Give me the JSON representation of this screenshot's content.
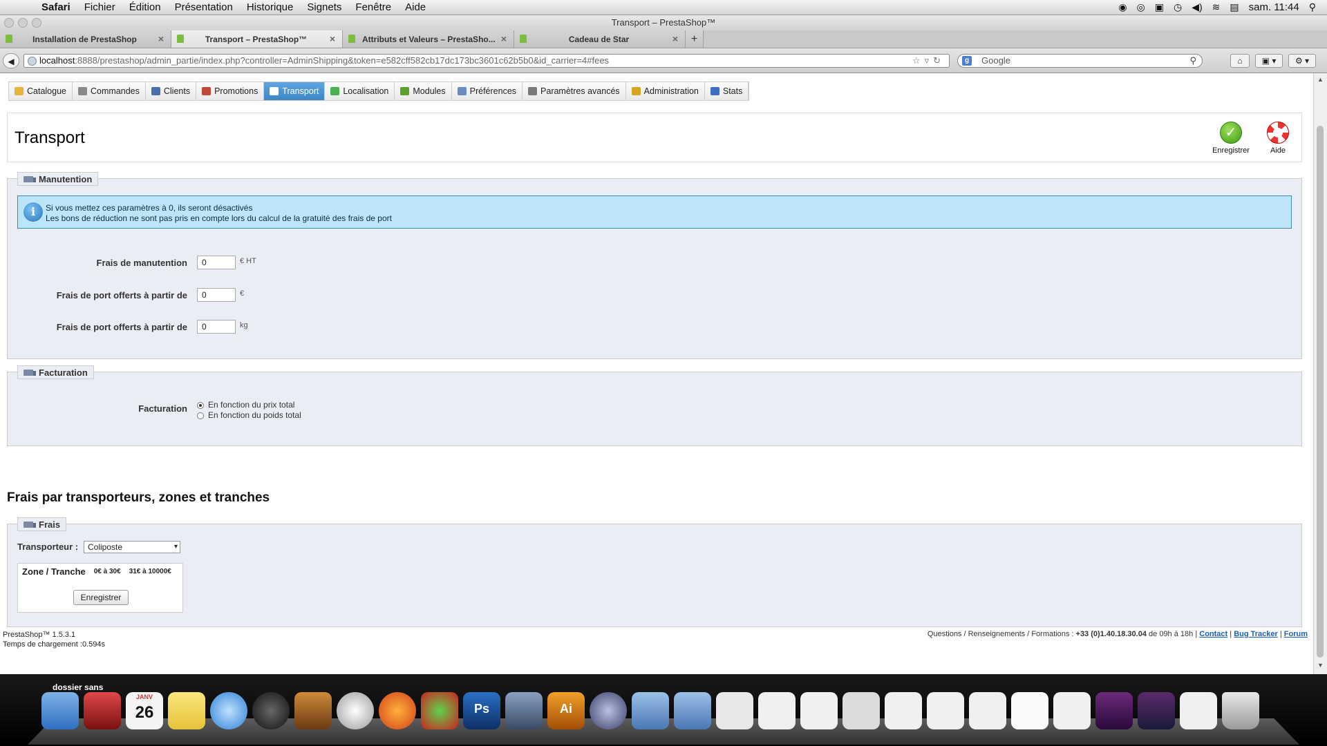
{
  "menubar": {
    "items": [
      "Safari",
      "Fichier",
      "Édition",
      "Présentation",
      "Historique",
      "Signets",
      "Fenêtre",
      "Aide"
    ],
    "clock": "sam. 11:44"
  },
  "window": {
    "title": "Transport – PrestaShop™"
  },
  "tabs": [
    {
      "label": "Installation de PrestaShop"
    },
    {
      "label": "Transport – PrestaShop™"
    },
    {
      "label": "Attributs et Valeurs – PrestaSho..."
    },
    {
      "label": "Cadeau de Star"
    }
  ],
  "newtab_label": "+",
  "address": {
    "host": "localhost",
    "rest": ":8888/prestashop/admin_partie/index.php?controller=AdminShipping&token=e582cff582cb17dc173bc3601c62b5b0&id_carrier=4#fees",
    "search_placeholder": "Google"
  },
  "nav": [
    {
      "label": "Catalogue",
      "color": "#e7b43a"
    },
    {
      "label": "Commandes",
      "color": "#8a8a8a"
    },
    {
      "label": "Clients",
      "color": "#4a6fae"
    },
    {
      "label": "Promotions",
      "color": "#c2473a"
    },
    {
      "label": "Transport",
      "color": "#ffffff"
    },
    {
      "label": "Localisation",
      "color": "#4caf50"
    },
    {
      "label": "Modules",
      "color": "#5aa02c"
    },
    {
      "label": "Préférences",
      "color": "#6a8cc0"
    },
    {
      "label": "Paramètres avancés",
      "color": "#7a7a7a"
    },
    {
      "label": "Administration",
      "color": "#d9a520"
    },
    {
      "label": "Stats",
      "color": "#3c6fc1"
    }
  ],
  "toolbar": {
    "title": "Transport",
    "save_label": "Enregistrer",
    "help_label": "Aide"
  },
  "handling": {
    "legend": "Manutention",
    "info_line1": "Si vous mettez ces paramètres à 0, ils seront désactivés",
    "info_line2": "Les bons de réduction ne sont pas pris en compte lors du calcul de la gratuité des frais de port",
    "fields": [
      {
        "label": "Frais de manutention",
        "value": "0",
        "unit": "€ HT"
      },
      {
        "label": "Frais de port offerts à partir de",
        "value": "0",
        "unit": "€"
      },
      {
        "label": "Frais de port offerts à partir de",
        "value": "0",
        "unit": "kg"
      }
    ]
  },
  "billing": {
    "legend": "Facturation",
    "label": "Facturation",
    "options": [
      "En fonction du prix total",
      "En fonction du poids total"
    ],
    "selected_index": 0
  },
  "fees_section": {
    "title": "Frais par transporteurs, zones et tranches",
    "legend": "Frais",
    "carrier_label": "Transporteur :",
    "carrier_value": "Coliposte",
    "table_headers": [
      "Zone / Tranche",
      "0€ à 30€",
      "31€ à 10000€"
    ],
    "save_label": "Enregistrer"
  },
  "footer": {
    "version": "PrestaShop™ 1.5.3.1",
    "load_time": "Temps de chargement :0.594s",
    "contact_prefix": "Questions / Renseignements / Formations :",
    "phone": "+33 (0)1.40.18.30.04",
    "hours": "de 09h à 18h |",
    "links": [
      "Contact",
      "Bug Tracker",
      "Forum"
    ]
  },
  "dock": {
    "label": "dossier sans",
    "calendar_day": "26",
    "calendar_month": "JANV",
    "ps_label": "Ps",
    "ai_label": "Ai"
  }
}
